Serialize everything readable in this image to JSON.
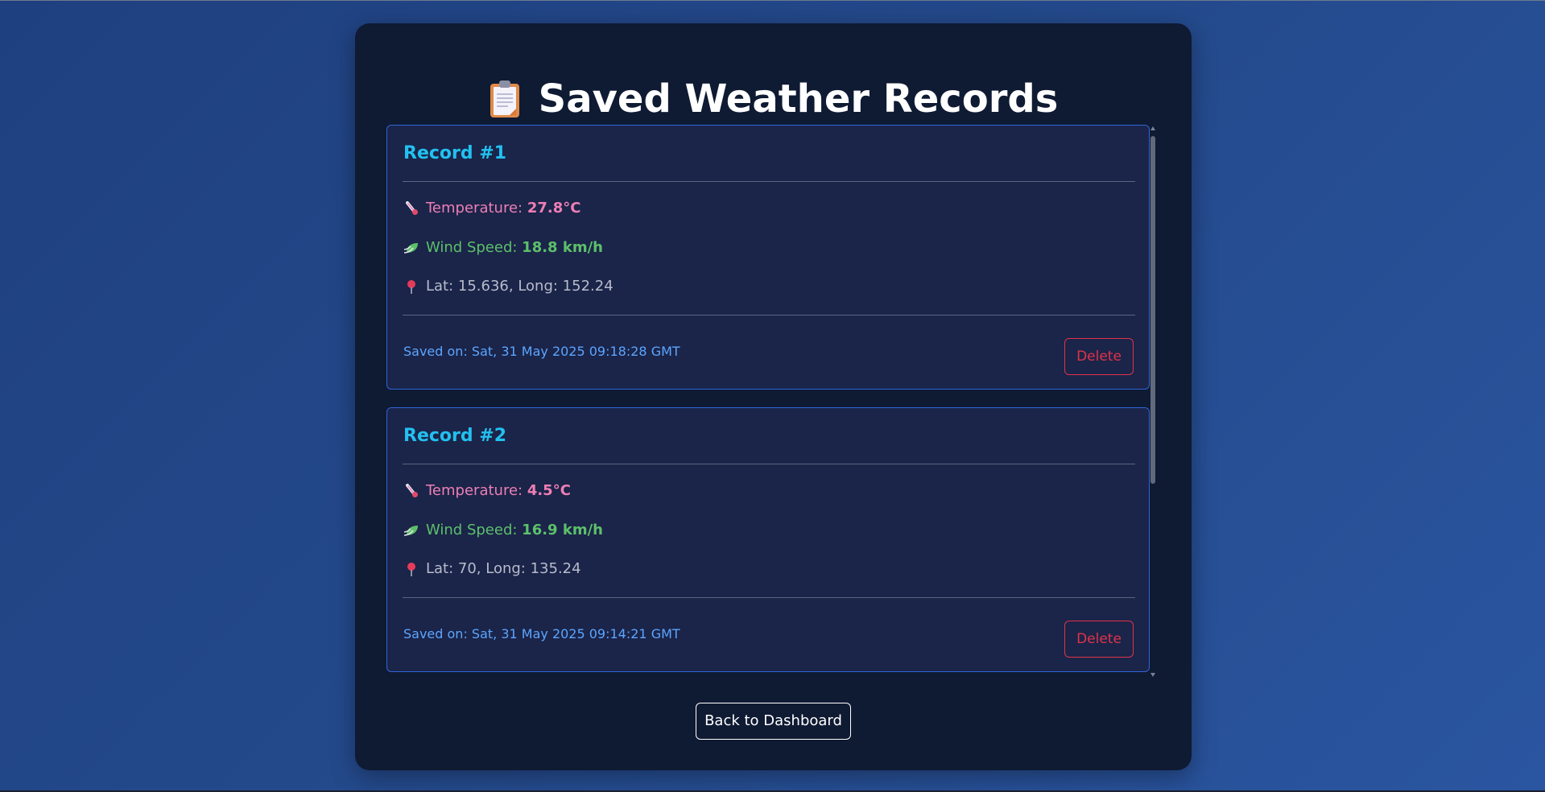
{
  "page": {
    "title": "Saved Weather Records",
    "title_icon": "clipboard-icon",
    "back_button_label": "Back to Dashboard"
  },
  "colors": {
    "record_title": "#22c0f0",
    "temperature": "#ec7fb5",
    "wind": "#5cc06a",
    "location": "#b7bccb",
    "saved_on": "#5ba6ff",
    "delete": "#e0334a",
    "card_border": "#2d66d8"
  },
  "records": [
    {
      "title": "Record #1",
      "temperature_label": "Temperature: ",
      "temperature_value": "27.8°C",
      "wind_label": "Wind Speed: ",
      "wind_value": "18.8 km/h",
      "location": "Lat: 15.636, Long: 152.24",
      "saved_on": "Saved on: Sat, 31 May 2025 09:18:28 GMT",
      "delete_label": "Delete"
    },
    {
      "title": "Record #2",
      "temperature_label": "Temperature: ",
      "temperature_value": "4.5°C",
      "wind_label": "Wind Speed: ",
      "wind_value": "16.9 km/h",
      "location": "Lat: 70, Long: 135.24",
      "saved_on": "Saved on: Sat, 31 May 2025 09:14:21 GMT",
      "delete_label": "Delete"
    }
  ]
}
